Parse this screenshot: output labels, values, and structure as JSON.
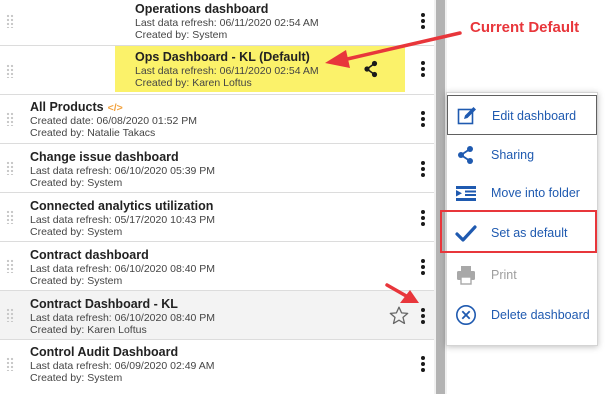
{
  "dashboards": [
    {
      "title": "Operations dashboard",
      "line1": "Last data refresh: 06/11/2020 02:54 AM",
      "line2": "Created by: System"
    },
    {
      "title": "Ops Dashboard - KL (Default)",
      "line1": "Last data refresh: 06/11/2020 02:54 AM",
      "line2": "Created by: Karen Loftus"
    },
    {
      "title": "All Products",
      "line1": "Created date: 06/08/2020 01:52 PM",
      "line2": "Created by: Natalie Takacs"
    },
    {
      "title": "Change issue dashboard",
      "line1": "Last data refresh: 06/10/2020 05:39 PM",
      "line2": "Created by: System"
    },
    {
      "title": "Connected analytics utilization",
      "line1": "Last data refresh: 05/17/2020 10:43 PM",
      "line2": "Created by: System"
    },
    {
      "title": "Contract dashboard",
      "line1": "Last data refresh: 06/10/2020 08:40 PM",
      "line2": "Created by: System"
    },
    {
      "title": "Contract Dashboard - KL",
      "line1": "Last data refresh: 06/10/2020 08:40 PM",
      "line2": "Created by: Karen Loftus"
    },
    {
      "title": "Control Audit Dashboard",
      "line1": "Last data refresh: 06/09/2020 02:49 AM",
      "line2": "Created by: System"
    }
  ],
  "menu": {
    "items": [
      {
        "label": "Edit dashboard",
        "icon": "edit-icon"
      },
      {
        "label": "Sharing",
        "icon": "share-icon"
      },
      {
        "label": "Move into folder",
        "icon": "move-folder-icon"
      },
      {
        "label": "Set as default",
        "icon": "checkmark-icon"
      },
      {
        "label": "Print",
        "icon": "print-icon"
      },
      {
        "label": "Delete dashboard",
        "icon": "delete-icon"
      }
    ]
  },
  "annotation": {
    "label": "Current Default"
  },
  "colors": {
    "highlight": "#fbf26a",
    "annotation": "#e8363b",
    "menu_text": "#1f5ab0",
    "code_icon": "#f2a13b"
  }
}
